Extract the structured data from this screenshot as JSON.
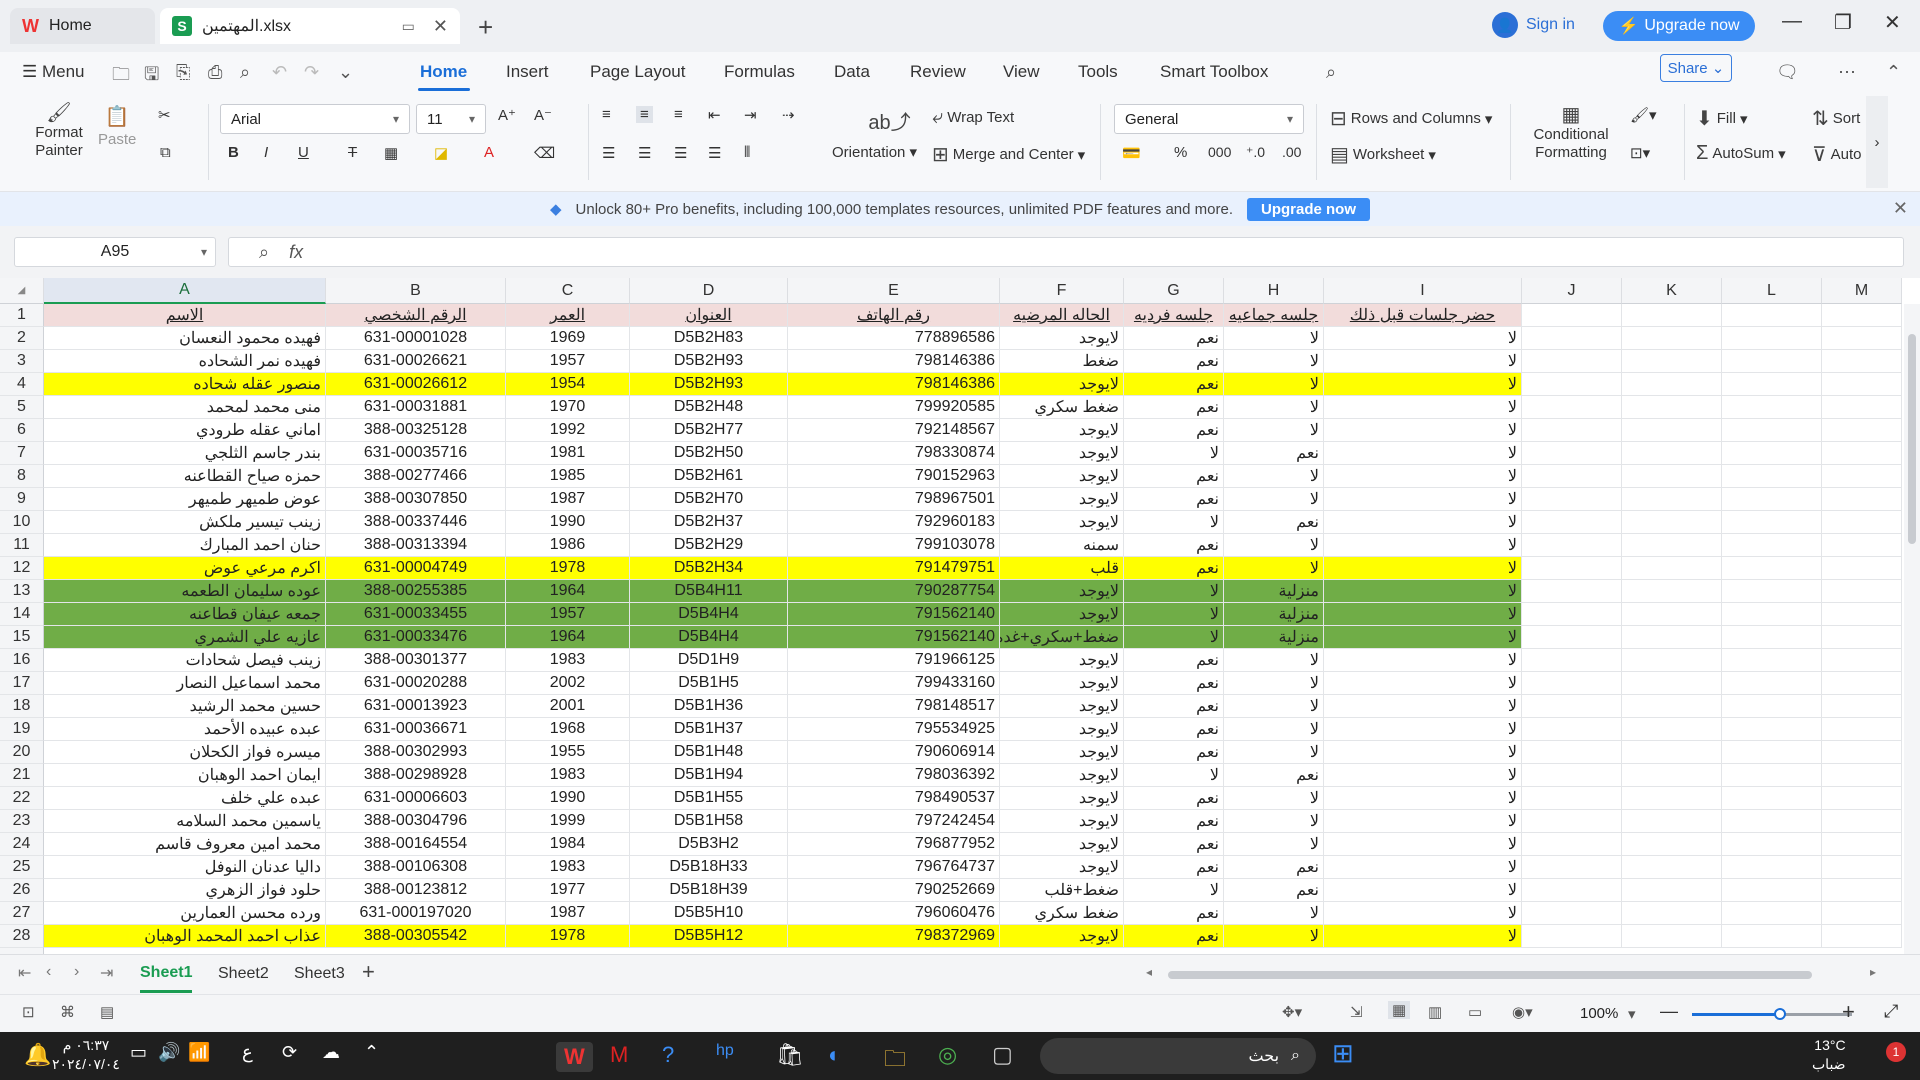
{
  "titlebar": {
    "home_tab": "Home",
    "file_tab": "المهتمين.xlsx",
    "sign_in": "Sign in",
    "upgrade": "Upgrade now"
  },
  "menubar": {
    "menu": "Menu",
    "tabs": [
      "Home",
      "Insert",
      "Page Layout",
      "Formulas",
      "Data",
      "Review",
      "View",
      "Tools",
      "Smart Toolbox"
    ],
    "share": "Share"
  },
  "ribbon": {
    "format_painter": "Format Painter",
    "paste": "Paste",
    "font_name": "Arial",
    "font_size": "11",
    "wrap_text": "Wrap Text",
    "orientation": "Orientation",
    "merge_center": "Merge and Center",
    "number_format": "General",
    "rows_columns": "Rows and Columns",
    "worksheet": "Worksheet",
    "conditional_formatting": "Conditional Formatting",
    "fill": "Fill",
    "autosum": "AutoSum",
    "sort": "Sort",
    "autofilter": "Auto"
  },
  "promo": {
    "text": "Unlock 80+ Pro benefits, including 100,000 templates resources, unlimited PDF features and more.",
    "button": "Upgrade now"
  },
  "formula": {
    "cell_ref": "A95",
    "fx": "fx",
    "content": ""
  },
  "grid": {
    "columns": [
      "A",
      "B",
      "C",
      "D",
      "E",
      "F",
      "G",
      "H",
      "I",
      "J",
      "K",
      "L",
      "M"
    ],
    "header": [
      "الاسم",
      "الرقم الشخصي",
      "العمر",
      "العنوان",
      "رقم الهاتف",
      "الحاله المرضيه",
      "جلسه فرديه",
      "جلسه جماعيه",
      "حضر جلسات قبل ذلك"
    ],
    "rows": [
      {
        "n": "2",
        "hl": "",
        "v": [
          "فهيده محمود النعسان",
          "631-00001028",
          "1969",
          "D5B2H83",
          "778896586",
          "لايوجد",
          "نعم",
          "لا",
          "لا"
        ]
      },
      {
        "n": "3",
        "hl": "",
        "v": [
          "فهيده نمر الشحاده",
          "631-00026621",
          "1957",
          "D5B2H93",
          "798146386",
          "ضغط",
          "نعم",
          "لا",
          "لا"
        ]
      },
      {
        "n": "4",
        "hl": "yellow",
        "v": [
          "منصور عقله شحاده",
          "631-00026612",
          "1954",
          "D5B2H93",
          "798146386",
          "لايوجد",
          "نعم",
          "لا",
          "لا"
        ]
      },
      {
        "n": "5",
        "hl": "",
        "v": [
          "منى محمد لمحمد",
          "631-00031881",
          "1970",
          "D5B2H48",
          "799920585",
          "ضغط سكري",
          "نعم",
          "لا",
          "لا"
        ]
      },
      {
        "n": "6",
        "hl": "",
        "v": [
          "اماني عقله طرودي",
          "388-00325128",
          "1992",
          "D5B2H77",
          "792148567",
          "لايوجد",
          "نعم",
          "لا",
          "لا"
        ]
      },
      {
        "n": "7",
        "hl": "",
        "v": [
          "بندر جاسم الثلجي",
          "631-00035716",
          "1981",
          "D5B2H50",
          "798330874",
          "لايوجد",
          "لا",
          "نعم",
          "لا"
        ]
      },
      {
        "n": "8",
        "hl": "",
        "v": [
          "حمزه صياح القطاعنه",
          "388-00277466",
          "1985",
          "D5B2H61",
          "790152963",
          "لايوجد",
          "نعم",
          "لا",
          "لا"
        ]
      },
      {
        "n": "9",
        "hl": "",
        "v": [
          "عوض طميهر طميهر",
          "388-00307850",
          "1987",
          "D5B2H70",
          "798967501",
          "لايوجد",
          "نعم",
          "لا",
          "لا"
        ]
      },
      {
        "n": "10",
        "hl": "",
        "v": [
          "زينب تيسير ملكش",
          "388-00337446",
          "1990",
          "D5B2H37",
          "792960183",
          "لايوجد",
          "لا",
          "نعم",
          "لا"
        ]
      },
      {
        "n": "11",
        "hl": "",
        "v": [
          "حنان احمد المبارك",
          "388-00313394",
          "1986",
          "D5B2H29",
          "799103078",
          "سمنه",
          "نعم",
          "لا",
          "لا"
        ]
      },
      {
        "n": "12",
        "hl": "yellow",
        "v": [
          "اكرم مرعي عوض",
          "631-00004749",
          "1978",
          "D5B2H34",
          "791479751",
          "قلب",
          "نعم",
          "لا",
          "لا"
        ]
      },
      {
        "n": "13",
        "hl": "green",
        "v": [
          "عوده سليمان الطعمه",
          "388-00255385",
          "1964",
          "D5B4H11",
          "790287754",
          "لايوجد",
          "لا",
          "منزلية",
          "لا"
        ]
      },
      {
        "n": "14",
        "hl": "green",
        "v": [
          "جمعه عيفان قطاعنه",
          "631-00033455",
          "1957",
          "D5B4H4",
          "791562140",
          "لايوجد",
          "لا",
          "منزلية",
          "لا"
        ]
      },
      {
        "n": "15",
        "hl": "green",
        "v": [
          "عازيه علي الشمري",
          "631-00033476",
          "1964",
          "D5B4H4",
          "791562140",
          "ضغط+سكري+غده",
          "لا",
          "منزلية",
          "لا"
        ]
      },
      {
        "n": "16",
        "hl": "",
        "v": [
          "زينب فيصل شحادات",
          "388-00301377",
          "1983",
          "D5D1H9",
          "791966125",
          "لايوجد",
          "نعم",
          "لا",
          "لا"
        ]
      },
      {
        "n": "17",
        "hl": "",
        "v": [
          "محمد اسماعيل النصار",
          "631-00020288",
          "2002",
          "D5B1H5",
          "799433160",
          "لايوجد",
          "نعم",
          "لا",
          "لا"
        ]
      },
      {
        "n": "18",
        "hl": "",
        "v": [
          "حسين محمد الرشيد",
          "631-00013923",
          "2001",
          "D5B1H36",
          "798148517",
          "لايوجد",
          "نعم",
          "لا",
          "لا"
        ]
      },
      {
        "n": "19",
        "hl": "",
        "v": [
          "عبده عبيده الأحمد",
          "631-00036671",
          "1968",
          "D5B1H37",
          "795534925",
          "لايوجد",
          "نعم",
          "لا",
          "لا"
        ]
      },
      {
        "n": "20",
        "hl": "",
        "v": [
          "ميسره فواز الكحلان",
          "388-00302993",
          "1955",
          "D5B1H48",
          "790606914",
          "لايوجد",
          "نعم",
          "لا",
          "لا"
        ]
      },
      {
        "n": "21",
        "hl": "",
        "v": [
          "ايمان احمد الوهبان",
          "388-00298928",
          "1983",
          "D5B1H94",
          "798036392",
          "لايوجد",
          "لا",
          "نعم",
          "لا"
        ]
      },
      {
        "n": "22",
        "hl": "",
        "v": [
          "عبده علي خلف",
          "631-00006603",
          "1990",
          "D5B1H55",
          "798490537",
          "لايوجد",
          "نعم",
          "لا",
          "لا"
        ]
      },
      {
        "n": "23",
        "hl": "",
        "v": [
          "ياسمين محمد السلامه",
          "388-00304796",
          "1999",
          "D5B1H58",
          "797242454",
          "لايوجد",
          "نعم",
          "لا",
          "لا"
        ]
      },
      {
        "n": "24",
        "hl": "",
        "v": [
          "محمد امين معروف قاسم",
          "388-00164554",
          "1984",
          "D5B3H2",
          "796877952",
          "لايوجد",
          "نعم",
          "لا",
          "لا"
        ]
      },
      {
        "n": "25",
        "hl": "",
        "v": [
          "داليا عدنان النوفل",
          "388-00106308",
          "1983",
          "D5B18H33",
          "796764737",
          "لايوجد",
          "نعم",
          "نعم",
          "لا"
        ]
      },
      {
        "n": "26",
        "hl": "",
        "v": [
          "حلود فواز الزهري",
          "388-00123812",
          "1977",
          "D5B18H39",
          "790252669",
          "ضغط+قلب",
          "لا",
          "نعم",
          "لا"
        ]
      },
      {
        "n": "27",
        "hl": "",
        "v": [
          "ورده محسن العمارين",
          "631-000197020",
          "1987",
          "D5B5H10",
          "796060476",
          "ضغط سكري",
          "نعم",
          "لا",
          "لا"
        ]
      },
      {
        "n": "28",
        "hl": "yellow",
        "v": [
          "عذاب احمد المحمد الوهبان",
          "388-00305542",
          "1978",
          "D5B5H12",
          "798372969",
          "لايوجد",
          "نعم",
          "لا",
          "لا"
        ]
      }
    ]
  },
  "sheets": [
    "Sheet1",
    "Sheet2",
    "Sheet3"
  ],
  "status": {
    "zoom": "100%",
    "zoom_level": 0.55
  },
  "taskbar": {
    "time": "٠٦:٣٧ م",
    "date": "٢٠٢٤/٠٧/٠٤",
    "lang": "ع",
    "search": "بحث",
    "weather_temp": "13°C",
    "weather_desc": "ضباب",
    "notifications": "1"
  }
}
